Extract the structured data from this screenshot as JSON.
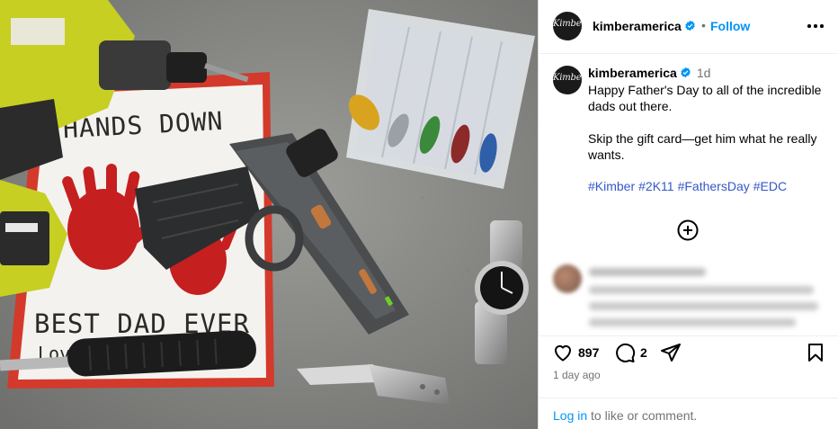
{
  "colors": {
    "accent_blue": "#0095f6",
    "hashtag_blue": "#3557c7",
    "muted_text": "#737373",
    "border": "#dbdbdb"
  },
  "post_image": {
    "sign_text_top": "HANDS DOWN",
    "sign_text_bottom": "BEST DAD EVER",
    "sign_text_love": "Love",
    "icons": [
      "drill",
      "pistol",
      "fishing-lures-box",
      "watch",
      "knife",
      "hammer",
      "handprints"
    ]
  },
  "header": {
    "avatar_logo": "Kimber",
    "username": "kimberamerica",
    "separator": "•",
    "follow_label": "Follow",
    "more_icon": "more-horizontal-icon"
  },
  "caption": {
    "avatar_logo": "Kimber",
    "username": "kimberamerica",
    "time": "1d",
    "text": "Happy Father's Day to all of the incredible dads out there.\n\nSkip the gift card—get him what he really wants.",
    "hashtags": [
      "#Kimber",
      "#2K11",
      "#FathersDay",
      "#EDC"
    ]
  },
  "comments": {
    "load_more_icon": "plus-circle-icon"
  },
  "actions": {
    "likes": "897",
    "comments_count": "2",
    "posted_ago": "1 day ago",
    "login_link": "Log in",
    "login_suffix": " to like or comment."
  }
}
